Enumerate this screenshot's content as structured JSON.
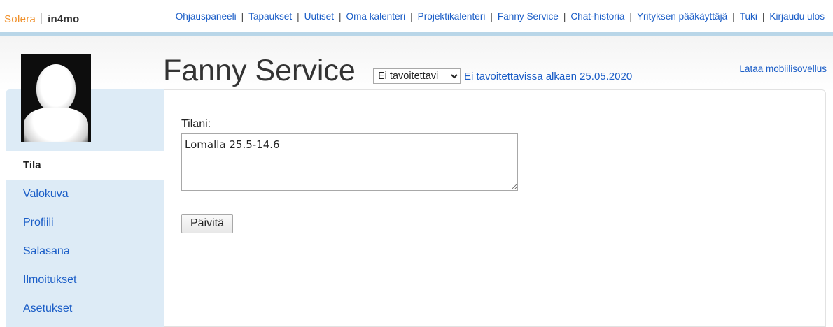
{
  "header": {
    "logo": {
      "brand": "Solera",
      "product": "in4mo"
    },
    "nav": [
      {
        "label": "Ohjauspaneeli"
      },
      {
        "label": "Tapaukset"
      },
      {
        "label": "Uutiset"
      },
      {
        "label": "Oma kalenteri"
      },
      {
        "label": "Projektikalenteri"
      },
      {
        "label": "Fanny Service"
      },
      {
        "label": "Chat-historia"
      },
      {
        "label": "Yrityksen pääkäyttäjä"
      },
      {
        "label": "Tuki"
      },
      {
        "label": "Kirjaudu ulos"
      }
    ],
    "accent_color": "#b9d6e8"
  },
  "profile": {
    "name": "Fanny Service",
    "availability": {
      "selected": "Ei tavoitettavi",
      "status_text": "Ei tavoitettavissa alkaen 25.05.2020"
    },
    "mobile_link": "Lataa mobiilisovellus"
  },
  "sidebar": {
    "items": [
      {
        "label": "Tila",
        "active": true
      },
      {
        "label": "Valokuva"
      },
      {
        "label": "Profiili"
      },
      {
        "label": "Salasana"
      },
      {
        "label": "Ilmoitukset"
      },
      {
        "label": "Asetukset"
      }
    ]
  },
  "form": {
    "label": "Tilani:",
    "value": "Lomalla 25.5-14.6",
    "button": "Päivitä"
  },
  "colors": {
    "link": "#1a5dc7",
    "sidebar_bg": "#ddebf6"
  }
}
